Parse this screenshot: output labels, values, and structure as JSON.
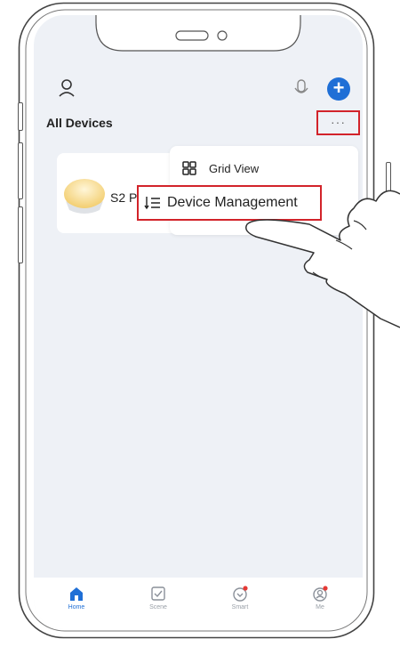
{
  "header": {
    "title": "All Devices",
    "more_label": "···"
  },
  "device": {
    "name": "S2 Pro"
  },
  "menu": {
    "items": [
      {
        "label": "Grid View",
        "icon": "grid-icon"
      },
      {
        "label": "Device Management",
        "icon": "sort-list-icon"
      }
    ]
  },
  "tabs": [
    {
      "label": "Home",
      "icon": "home-icon",
      "active": true
    },
    {
      "label": "Scene",
      "icon": "scene-icon",
      "active": false
    },
    {
      "label": "Smart",
      "icon": "smart-icon",
      "active": false
    },
    {
      "label": "Me",
      "icon": "profile-icon",
      "active": false
    }
  ],
  "colors": {
    "accent": "#1f6fd6",
    "highlight": "#d2232a",
    "screen_bg": "#eef1f6",
    "badge": "#e53935"
  }
}
